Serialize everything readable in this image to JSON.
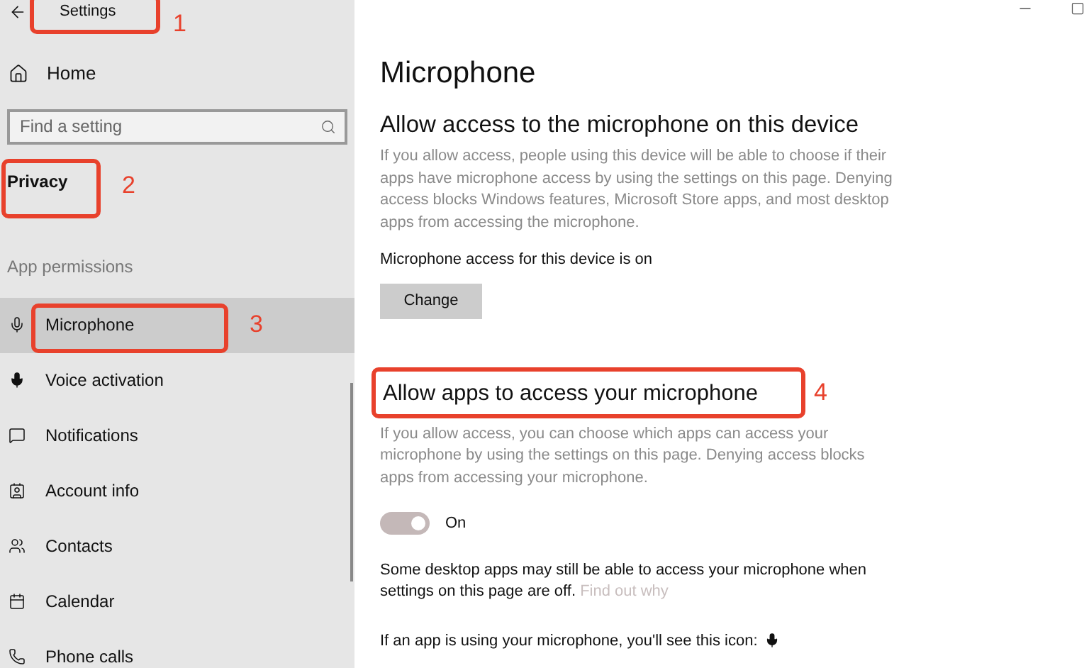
{
  "window": {
    "title": "Settings"
  },
  "sidebar": {
    "home": "Home",
    "search": {
      "placeholder": "Find a setting"
    },
    "section": "Privacy",
    "group": "App permissions",
    "items": [
      {
        "label": "Microphone",
        "kind": "mic",
        "selected": true
      },
      {
        "label": "Voice activation",
        "kind": "voice",
        "selected": false
      },
      {
        "label": "Notifications",
        "kind": "notify",
        "selected": false
      },
      {
        "label": "Account info",
        "kind": "account",
        "selected": false
      },
      {
        "label": "Contacts",
        "kind": "contacts",
        "selected": false
      },
      {
        "label": "Calendar",
        "kind": "calendar",
        "selected": false
      },
      {
        "label": "Phone calls",
        "kind": "phone",
        "selected": false
      }
    ]
  },
  "content": {
    "title": "Microphone",
    "device_heading": "Allow access to the microphone on this device",
    "device_text": "If you allow access, people using this device will be able to choose if their apps have microphone access by using the settings on this page. Denying access blocks Windows features, Microsoft Store apps, and most desktop apps from accessing the microphone.",
    "device_status": "Microphone access for this device is on",
    "change_button": "Change",
    "apps_heading": "Allow apps to access your microphone",
    "apps_text": "If you allow access, you can choose which apps can access your microphone by using the settings on this page. Denying access blocks apps from accessing your microphone.",
    "toggle": {
      "on": true,
      "label": "On"
    },
    "note": "Some desktop apps may still be able to access your microphone when settings on this page are off.",
    "note_link": "Find out why",
    "icon_note": "If an app is using your microphone, you'll see this icon:"
  },
  "annotations": [
    {
      "label": "1"
    },
    {
      "label": "2"
    },
    {
      "label": "3"
    },
    {
      "label": "4"
    }
  ]
}
